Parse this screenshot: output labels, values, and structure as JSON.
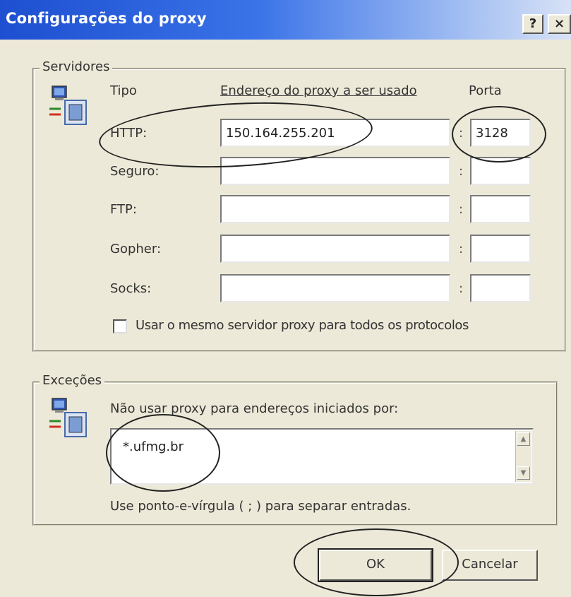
{
  "window": {
    "title": "Configurações do proxy",
    "help_label": "?",
    "close_label": "×"
  },
  "servers": {
    "legend": "Servidores",
    "col_type": "Tipo",
    "col_address": "Endereço do proxy a ser usado",
    "col_port": "Porta",
    "separator": ":",
    "rows": [
      {
        "label": "HTTP:",
        "address": "150.164.255.201",
        "port": "3128"
      },
      {
        "label": "Seguro:",
        "address": "",
        "port": ""
      },
      {
        "label": "FTP:",
        "address": "",
        "port": ""
      },
      {
        "label": "Gopher:",
        "address": "",
        "port": ""
      },
      {
        "label": "Socks:",
        "address": "",
        "port": ""
      }
    ],
    "same_proxy_label": "Usar o mesmo servidor proxy para todos os protocolos",
    "same_proxy_checked": false
  },
  "exceptions": {
    "legend": "Exceções",
    "instruction": "Não usar proxy para endereços iniciados por:",
    "value": "*.ufmg.br",
    "hint": "Use ponto-e-vírgula ( ; ) para separar entradas."
  },
  "buttons": {
    "ok": "OK",
    "cancel": "Cancelar"
  },
  "icons": {
    "network": "network-computer-icon",
    "scroll_up": "scroll-up-arrow-icon",
    "scroll_down": "scroll-down-arrow-icon"
  }
}
